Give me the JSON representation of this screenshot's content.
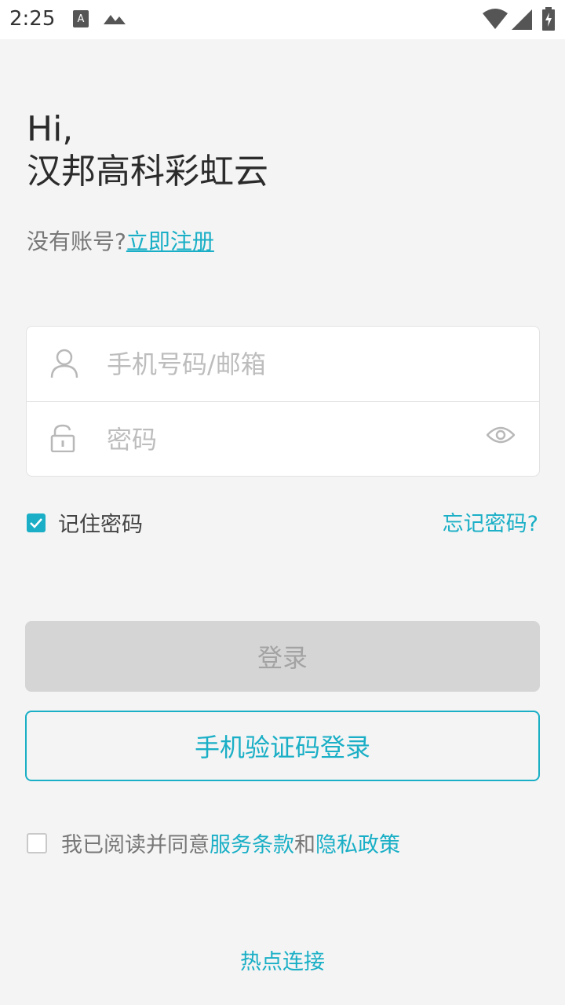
{
  "status_bar": {
    "time": "2:25",
    "icons": [
      "text-a-icon",
      "mountains-icon",
      "wifi-icon",
      "signal-icon",
      "battery-charging-icon"
    ]
  },
  "greeting": {
    "line1": "Hi,",
    "line2": "汉邦高科彩虹云"
  },
  "register": {
    "prompt": "没有账号?",
    "link": "立即注册"
  },
  "form": {
    "account_placeholder": "手机号码/邮箱",
    "password_placeholder": "密码",
    "account_value": "",
    "password_value": ""
  },
  "options": {
    "remember_label": "记住密码",
    "remember_checked": true,
    "forgot_label": "忘记密码?"
  },
  "buttons": {
    "login": "登录",
    "sms_login": "手机验证码登录"
  },
  "agreement": {
    "prefix": "我已阅读并同意",
    "terms": "服务条款",
    "and": "和",
    "privacy": "隐私政策",
    "checked": false
  },
  "footer": {
    "hotspot": "热点连接"
  },
  "colors": {
    "accent": "#1aafc6",
    "background": "#f4f4f4",
    "disabled_button": "#d5d5d5"
  }
}
